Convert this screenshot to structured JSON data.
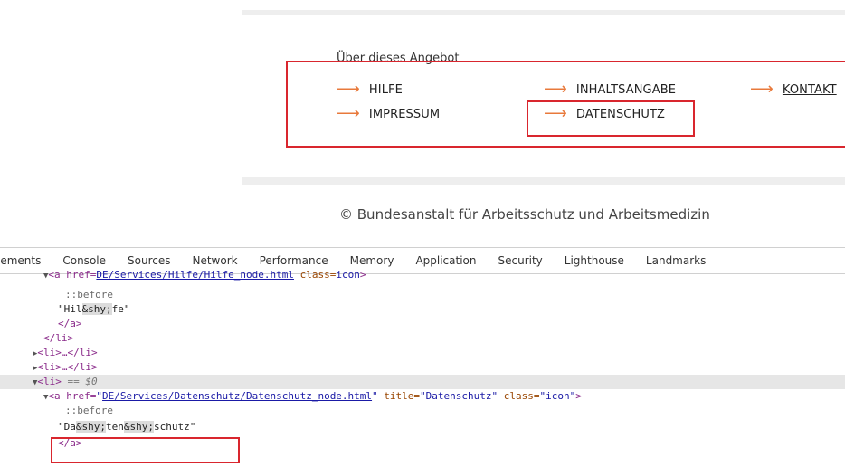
{
  "footer": {
    "heading": "Über dieses Angebot",
    "links": {
      "hilfe": "HILFE",
      "impressum": "IMPRESSUM",
      "inhaltsangabe": "INHALTSANGABE",
      "datenschutz": "DATENSCHUTZ",
      "kontakt": "KONTAKT"
    },
    "copyright": "© Bundesanstalt für Arbeitsschutz und Arbeitsmedizin"
  },
  "devtools": {
    "tabs": [
      "lements",
      "Console",
      "Sources",
      "Network",
      "Performance",
      "Memory",
      "Application",
      "Security",
      "Lighthouse",
      "Landmarks"
    ],
    "code": {
      "l0_href": "DE/Services/Hilfe/Hilfe_node.html",
      "l0_class": "icon",
      "pseudo_before": "::before",
      "hilfe_pre": "\"Hil",
      "shy": "&shy;",
      "hilfe_post": "fe\"",
      "a_close": "</a>",
      "li_close": "</li>",
      "li_collapsed": "<li>…</li>",
      "li_open": "<li>",
      "selected_marker": "== $0",
      "a_open": "<a href=",
      "href_daten": "DE/Services/Datenschutz/Datenschutz_node.html",
      "attr_title": "title=",
      "title_val": "\"Datenschutz\"",
      "attr_class": "class=",
      "class_val": "\"icon\"",
      "text_da": "\"Da",
      "text_ten": "ten",
      "text_schutz": "schutz\""
    }
  },
  "colors": {
    "accent": "#e8793b",
    "highlight_box": "#d9262e"
  }
}
